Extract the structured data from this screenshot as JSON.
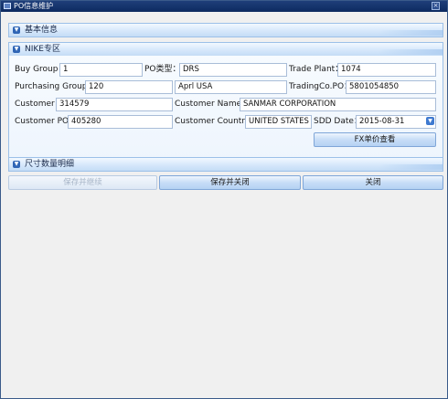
{
  "window": {
    "title": "PO信息维护",
    "close_glyph": "×"
  },
  "sections": {
    "basic_info": {
      "title": "基本信息"
    },
    "nike": {
      "title": "NIKE专区"
    },
    "size_detail": {
      "title": "尺寸数量明细"
    }
  },
  "form": {
    "buy_group": {
      "label": "Buy Group：",
      "value": "1"
    },
    "po_type": {
      "label": "PO类型：",
      "value": "DRS"
    },
    "trade_plant": {
      "label": "Trade Plant：",
      "value": "1074"
    },
    "purchasing_group": {
      "label": "Purchasing Group：",
      "value": "120"
    },
    "aprl_field": {
      "value": "Aprl USA"
    },
    "trading_co_po": {
      "label": "TradingCo.PO：",
      "value": "5801054850"
    },
    "customer": {
      "label": "Customer：",
      "value": "314579"
    },
    "customer_name": {
      "label": "Customer Name：",
      "value": "SANMAR CORPORATION"
    },
    "customer_po": {
      "label": "Customer PO：",
      "value": "405280"
    },
    "customer_country": {
      "label": "Customer Country：",
      "value": "UNITED STATES"
    },
    "sdd_date": {
      "label": "SDD Date：",
      "value": "2015-08-31"
    }
  },
  "buttons": {
    "fx_price": "FX单价查看",
    "save_continue": "保存并继续",
    "save_close": "保存并关闭",
    "close": "关闭"
  },
  "icons": {
    "section_toggle": "chevron-down-icon",
    "date_dropdown": "chevron-down-icon",
    "window_close": "close-icon"
  },
  "colors": {
    "title_bar": "#0d2a60",
    "section_header": "#d6e8fb",
    "accent": "#2f65b5"
  }
}
